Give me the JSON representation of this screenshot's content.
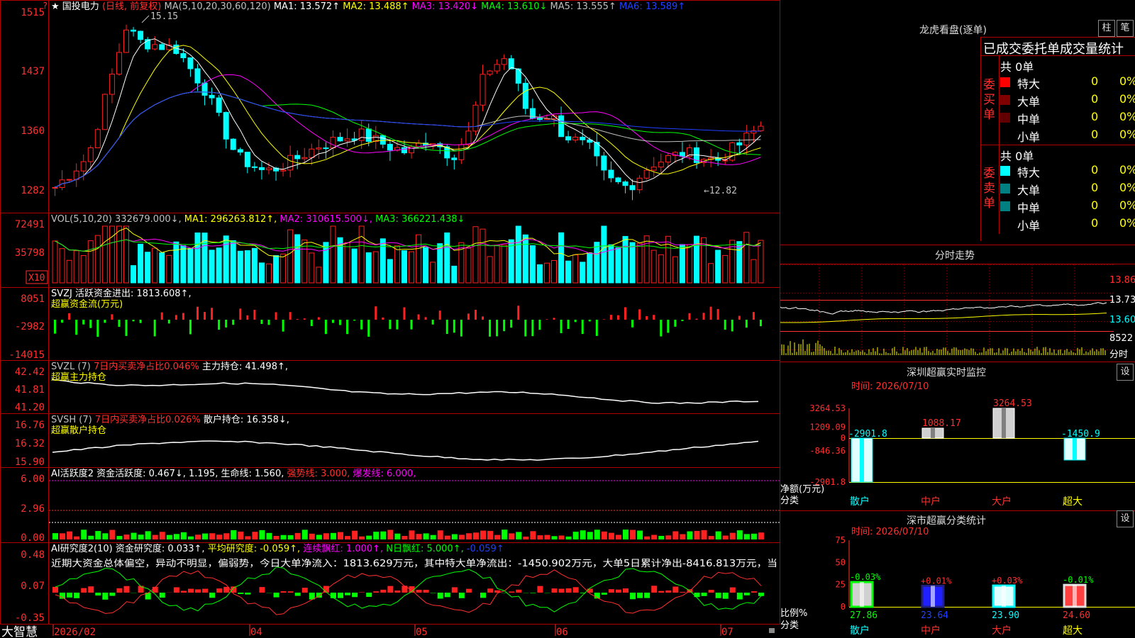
{
  "stock": {
    "name": "国投电力",
    "mode": "(日线, 前复权)",
    "star": "★"
  },
  "colors": {
    "up": "#ff2020",
    "down": "#00ffff",
    "bg": "#000000",
    "grid": "#b00000",
    "ma1": "#ffffff",
    "ma2": "#ffff00",
    "ma3": "#ff00ff",
    "ma4": "#00ff00",
    "ma5": "#c0c0c0",
    "ma6": "#2040ff"
  },
  "main": {
    "yticks": [
      "1515",
      "1437",
      "1360",
      "1282"
    ],
    "ma_header": "MA(5,10,20,30,60,120)",
    "ma": [
      {
        "label": "MA1: 13.572↑",
        "color": "#ffffff"
      },
      {
        "label": "MA2: 13.488↑",
        "color": "#ffff00"
      },
      {
        "label": "MA3: 13.420↓",
        "color": "#ff00ff"
      },
      {
        "label": "MA4: 13.610↓",
        "color": "#00ff00"
      },
      {
        "label": "MA5: 13.555↑",
        "color": "#c0c0c0"
      },
      {
        "label": "MA6: 13.589↑",
        "color": "#2040ff"
      }
    ],
    "high_label": "15.15",
    "low_label": "←12.82"
  },
  "vol": {
    "yticks": [
      "72491",
      "35798"
    ],
    "unit": "X10",
    "header": "VOL(5,10,20) 332679.000↓,",
    "ma1": "MA1: 296263.812↑,",
    "ma2": "MA2: 310615.500↓,",
    "ma3": "MA3: 366221.438↓"
  },
  "svzj": {
    "yticks": [
      "8051",
      "-2982",
      "-14015"
    ],
    "header": "SVZJ  活跃资金进出: 1813.608↑,",
    "sub": "超赢资金流(万元)"
  },
  "svzl": {
    "yticks": [
      "42.42",
      "41.81",
      "41.20"
    ],
    "name": "SVZL (7)",
    "ratio": "7日内买卖净占比0.046%",
    "hold": "主力持仓: 41.498↑,",
    "sub": "超赢主力持仓"
  },
  "svsh": {
    "yticks": [
      "16.76",
      "16.32",
      "15.90"
    ],
    "name": "SVSH (7)",
    "ratio": "7日内买卖净占比0.026%",
    "hold": "散户持仓: 16.358↓,",
    "sub": "超赢散户持仓"
  },
  "ai1": {
    "yticks": [
      "6.00",
      "2.96",
      "0.00"
    ],
    "header": "AI活跃度2 资金活跃度: 0.467↓, 1.195, 生命线: 1.560,",
    "strong": "强势线: 3.000,",
    "burst": "爆发线: 6.000,"
  },
  "ai2": {
    "yticks": [
      "0.48",
      "0.07",
      "-0.35"
    ],
    "header": "AI研究度2(10) 资金研究度: 0.033↑,",
    "avg": "平均研究度: -0.059↑,",
    "cont": "连续飘红: 1.000↑,",
    "nday": "N日飘红: 5.000↑,",
    "last": "-0.059↑",
    "text": "近期大资金总体偏空，异动不明显，偏弱势，今日大单净流入：1813.629万元，其中特大单净流出：-1450.902万元，大单5日累计净出-8416.813万元，当"
  },
  "xaxis": {
    "logo": "大智慧",
    "labels": [
      "2026/02",
      "04",
      "05",
      "06",
      "07"
    ]
  },
  "right": {
    "lhb_title": "龙虎看盘(逐单)",
    "btn1": "柱",
    "btn2": "笔",
    "stat_title": "已成交委托单成交量统计",
    "buy": {
      "side": "委买单",
      "total": "共 0单",
      "rows": [
        {
          "name": "特大",
          "v": "0",
          "p": "0%"
        },
        {
          "name": "大单",
          "v": "0",
          "p": "0%"
        },
        {
          "name": "中单",
          "v": "0",
          "p": "0%"
        },
        {
          "name": "小单",
          "v": "0",
          "p": "0%"
        }
      ]
    },
    "sell": {
      "side": "委卖单",
      "total": "共 0单",
      "rows": [
        {
          "name": "特大",
          "v": "0",
          "p": "0%"
        },
        {
          "name": "大单",
          "v": "0",
          "p": "0%"
        },
        {
          "name": "中单",
          "v": "0",
          "p": "0%"
        },
        {
          "name": "小单",
          "v": "0",
          "p": "0%"
        }
      ]
    },
    "intraday": {
      "title": "分时走势",
      "prices": [
        "13.86",
        "13.73",
        "13.60"
      ],
      "vol": "8522",
      "vol_unit": "分时"
    },
    "monitor": {
      "title": "深圳超赢实时监控",
      "set": "设",
      "time": "时间: 2026/07/10",
      "yticks": [
        "3264.53",
        "1209.09",
        "0",
        "-846.36",
        "-2901.8"
      ],
      "ylabel": "净额(万元)",
      "xlabel": "分类",
      "bars": [
        {
          "cat": "散户",
          "value": -2901.8,
          "label": "-2901.8"
        },
        {
          "cat": "中户",
          "value": 1088.17,
          "label": "1088.17"
        },
        {
          "cat": "大户",
          "value": 3264.53,
          "label": "3264.53"
        },
        {
          "cat": "超大",
          "value": -1450.9,
          "label": "-1450.9"
        }
      ]
    },
    "classify": {
      "title": "深市超赢分类统计",
      "set": "设",
      "time": "时间: 2026/07/10",
      "yticks": [
        "75",
        "50",
        "25",
        "0"
      ],
      "ylabel": "比例%",
      "xlabel": "分类",
      "bars": [
        {
          "cat": "散户",
          "value": 27.86,
          "pct": "-0.03%"
        },
        {
          "cat": "中户",
          "value": 23.64,
          "pct": "+0.01%"
        },
        {
          "cat": "大户",
          "value": 23.9,
          "pct": "+0.03%"
        },
        {
          "cat": "超大",
          "value": 24.6,
          "pct": "-0.01%"
        }
      ]
    }
  },
  "chart_data": {
    "type": "bar",
    "title": "",
    "categories": [
      "散户",
      "中户",
      "大户",
      "超大"
    ],
    "series": [
      {
        "name": "净额(万元)",
        "values": [
          -2901.8,
          1088.17,
          3264.53,
          -1450.9
        ]
      }
    ],
    "ylim": [
      -2901.8,
      3264.53
    ]
  }
}
